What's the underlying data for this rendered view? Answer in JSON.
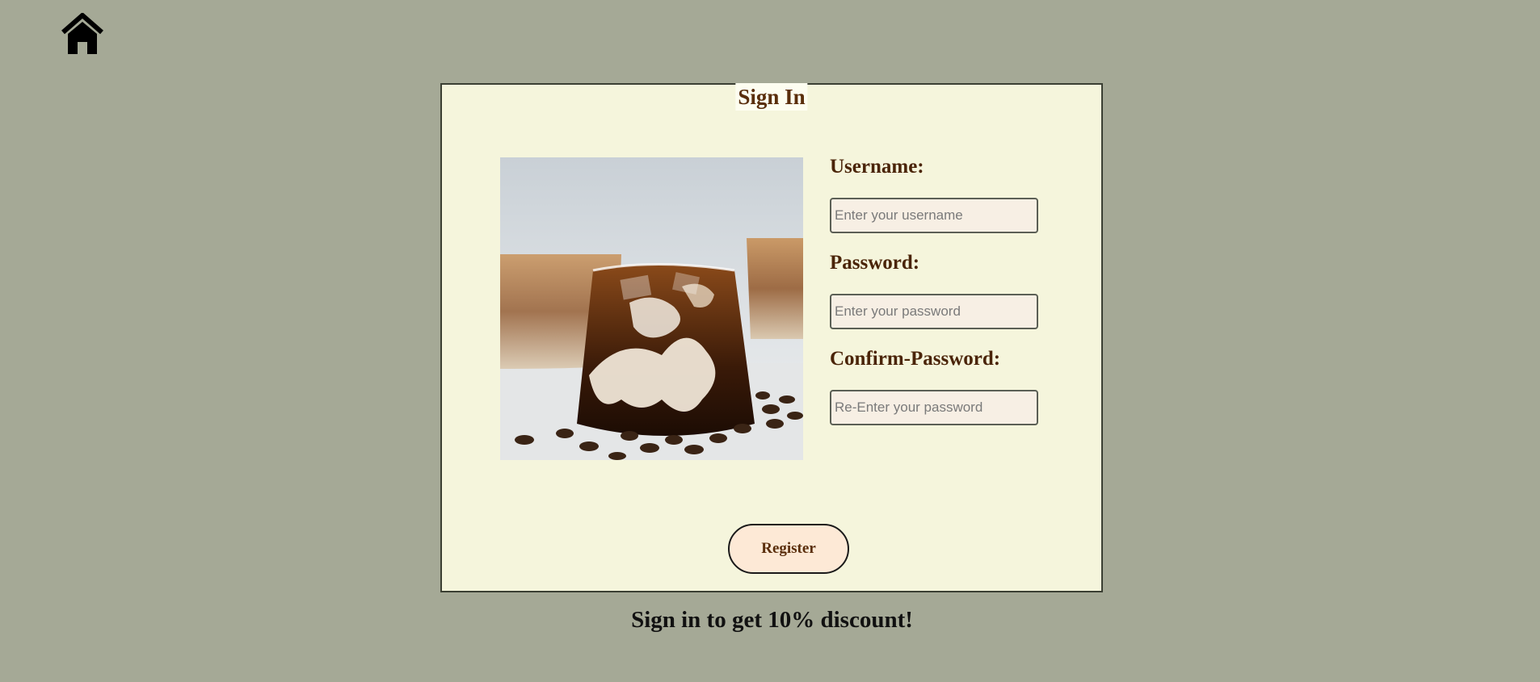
{
  "nav": {
    "home_icon": "home-icon"
  },
  "form": {
    "title": "Sign In",
    "username": {
      "label": "Username:",
      "placeholder": "Enter your username",
      "value": ""
    },
    "password": {
      "label": "Password:",
      "placeholder": "Enter your password",
      "value": ""
    },
    "confirm_password": {
      "label": "Confirm-Password:",
      "placeholder": "Re-Enter your password",
      "value": ""
    },
    "submit_label": "Register"
  },
  "promo_text": "Sign in to get 10% discount!",
  "colors": {
    "page_background": "#a5a996",
    "card_background": "#f5f5dc",
    "heading_brown": "#5a2e0c",
    "input_background": "#f7efe4",
    "button_background": "#fde9d6"
  }
}
